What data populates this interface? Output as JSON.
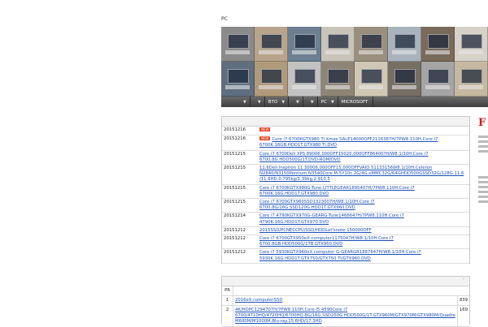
{
  "header": {
    "site_title": "PC"
  },
  "nav": {
    "items": [
      {
        "label": "",
        "dropdown": true
      },
      {
        "label": "",
        "dropdown": true
      },
      {
        "label": "BTO",
        "dropdown": true
      },
      {
        "label": "",
        "dropdown": true
      },
      {
        "label": "",
        "dropdown": true
      },
      {
        "label": "PC",
        "dropdown": true
      },
      {
        "label": "MICROSOFT",
        "dropdown": false
      }
    ]
  },
  "news": {
    "rows": [
      {
        "date": "20151216",
        "badge": "NEW",
        "text": ""
      },
      {
        "date": "20151216",
        "badge": "NEW",
        "text": "Core i7 6700KGTX980 Ti Xmas SALE14000OFF2116387H/7PW8.110H.Core i7 6700K.16GB.HDD1T.GTX980 Ti.DVD"
      },
      {
        "date": "20151215",
        "badge": "",
        "text": "Core i7 6700Dell XPS 89006,000OFF15020,000OFF86400?H/W8.1/10H.Core i7 6700.8G.HDD500G/1T.DVD-ROM/DVD"
      },
      {
        "date": "20151215",
        "badge": "",
        "text": "11.6Dell Inspiron 11 30006,000OFF15,000OFFVAIO 51133156W8.1/10H.Celeron N2840/N3150Pentium N3540Core M-5Y10c.2G/4G.eMMC32G/64GHDD500GSSD32G/128G.11.6 /11.6HD.0.795kg/1.39kg.2.910.5"
      },
      {
        "date": "20151215",
        "badge": "",
        "text": "Core i7 6700KGTX980G-Tune LITTLEGEAR1895407H/7PW8.110H.Core i7 6700K.16G.HDD1T.GTX980.DVD"
      },
      {
        "date": "20151215",
        "badge": "",
        "text": "Core i7 6700GTX960SSD1323007H/W8.1/10H.Core i7 6700.8G/16G.SSD120G.HDD1T.GTX960.DVD"
      },
      {
        "date": "20151214",
        "badge": "",
        "text": "Core i7 4790KGTX970G-GEARG-Tune1466647H/7PW8.110H.Core i7 4790K.16G.HDD1T.GTX970.DVD"
      },
      {
        "date": "20151212",
        "badge": "",
        "text": "2015SSD/PCNECCPU/SSD/HDDLet'snote 150000OFF"
      },
      {
        "date": "20151212",
        "badge": "",
        "text": "Core i7 6700GTX950eX.computer1175047H/W8.1/10H.Core i7 6700.8GB.HDD500G/1TB.GTX950.DVD"
      },
      {
        "date": "20151212",
        "badge": "",
        "text": "Core i7 5930KGTX960eX.computer G-GEARGR1887847H/W8.1/10H.Core i7 5930K.16G.HDD1T.GTX750/GTX750 Ti/GTX960.DVD"
      }
    ]
  },
  "ranking": {
    "col_count_header": "-",
    "pr_label": "PR",
    "pr_text": "",
    "rows": [
      {
        "rank": "1",
        "name": "2016eX.computerSSD",
        "count": "839"
      },
      {
        "rank": "2",
        "name": "4K/HDPC1294707H/7PW8.110H.Core i5 4590Core i7 6700/4710HQ/4720HQ/6700HQ.8G/16G.SSD250G.HDD500G/1T.GTX960M/GTX970M/GTX980M/Quadro M600M/M1000M.Blu-ray.15.6HD/17.3HD",
        "count": "169"
      }
    ]
  },
  "colors": {
    "link": "#1a4fb8",
    "badge": "#e8401c",
    "nav_bg": "#4a4a4a"
  }
}
